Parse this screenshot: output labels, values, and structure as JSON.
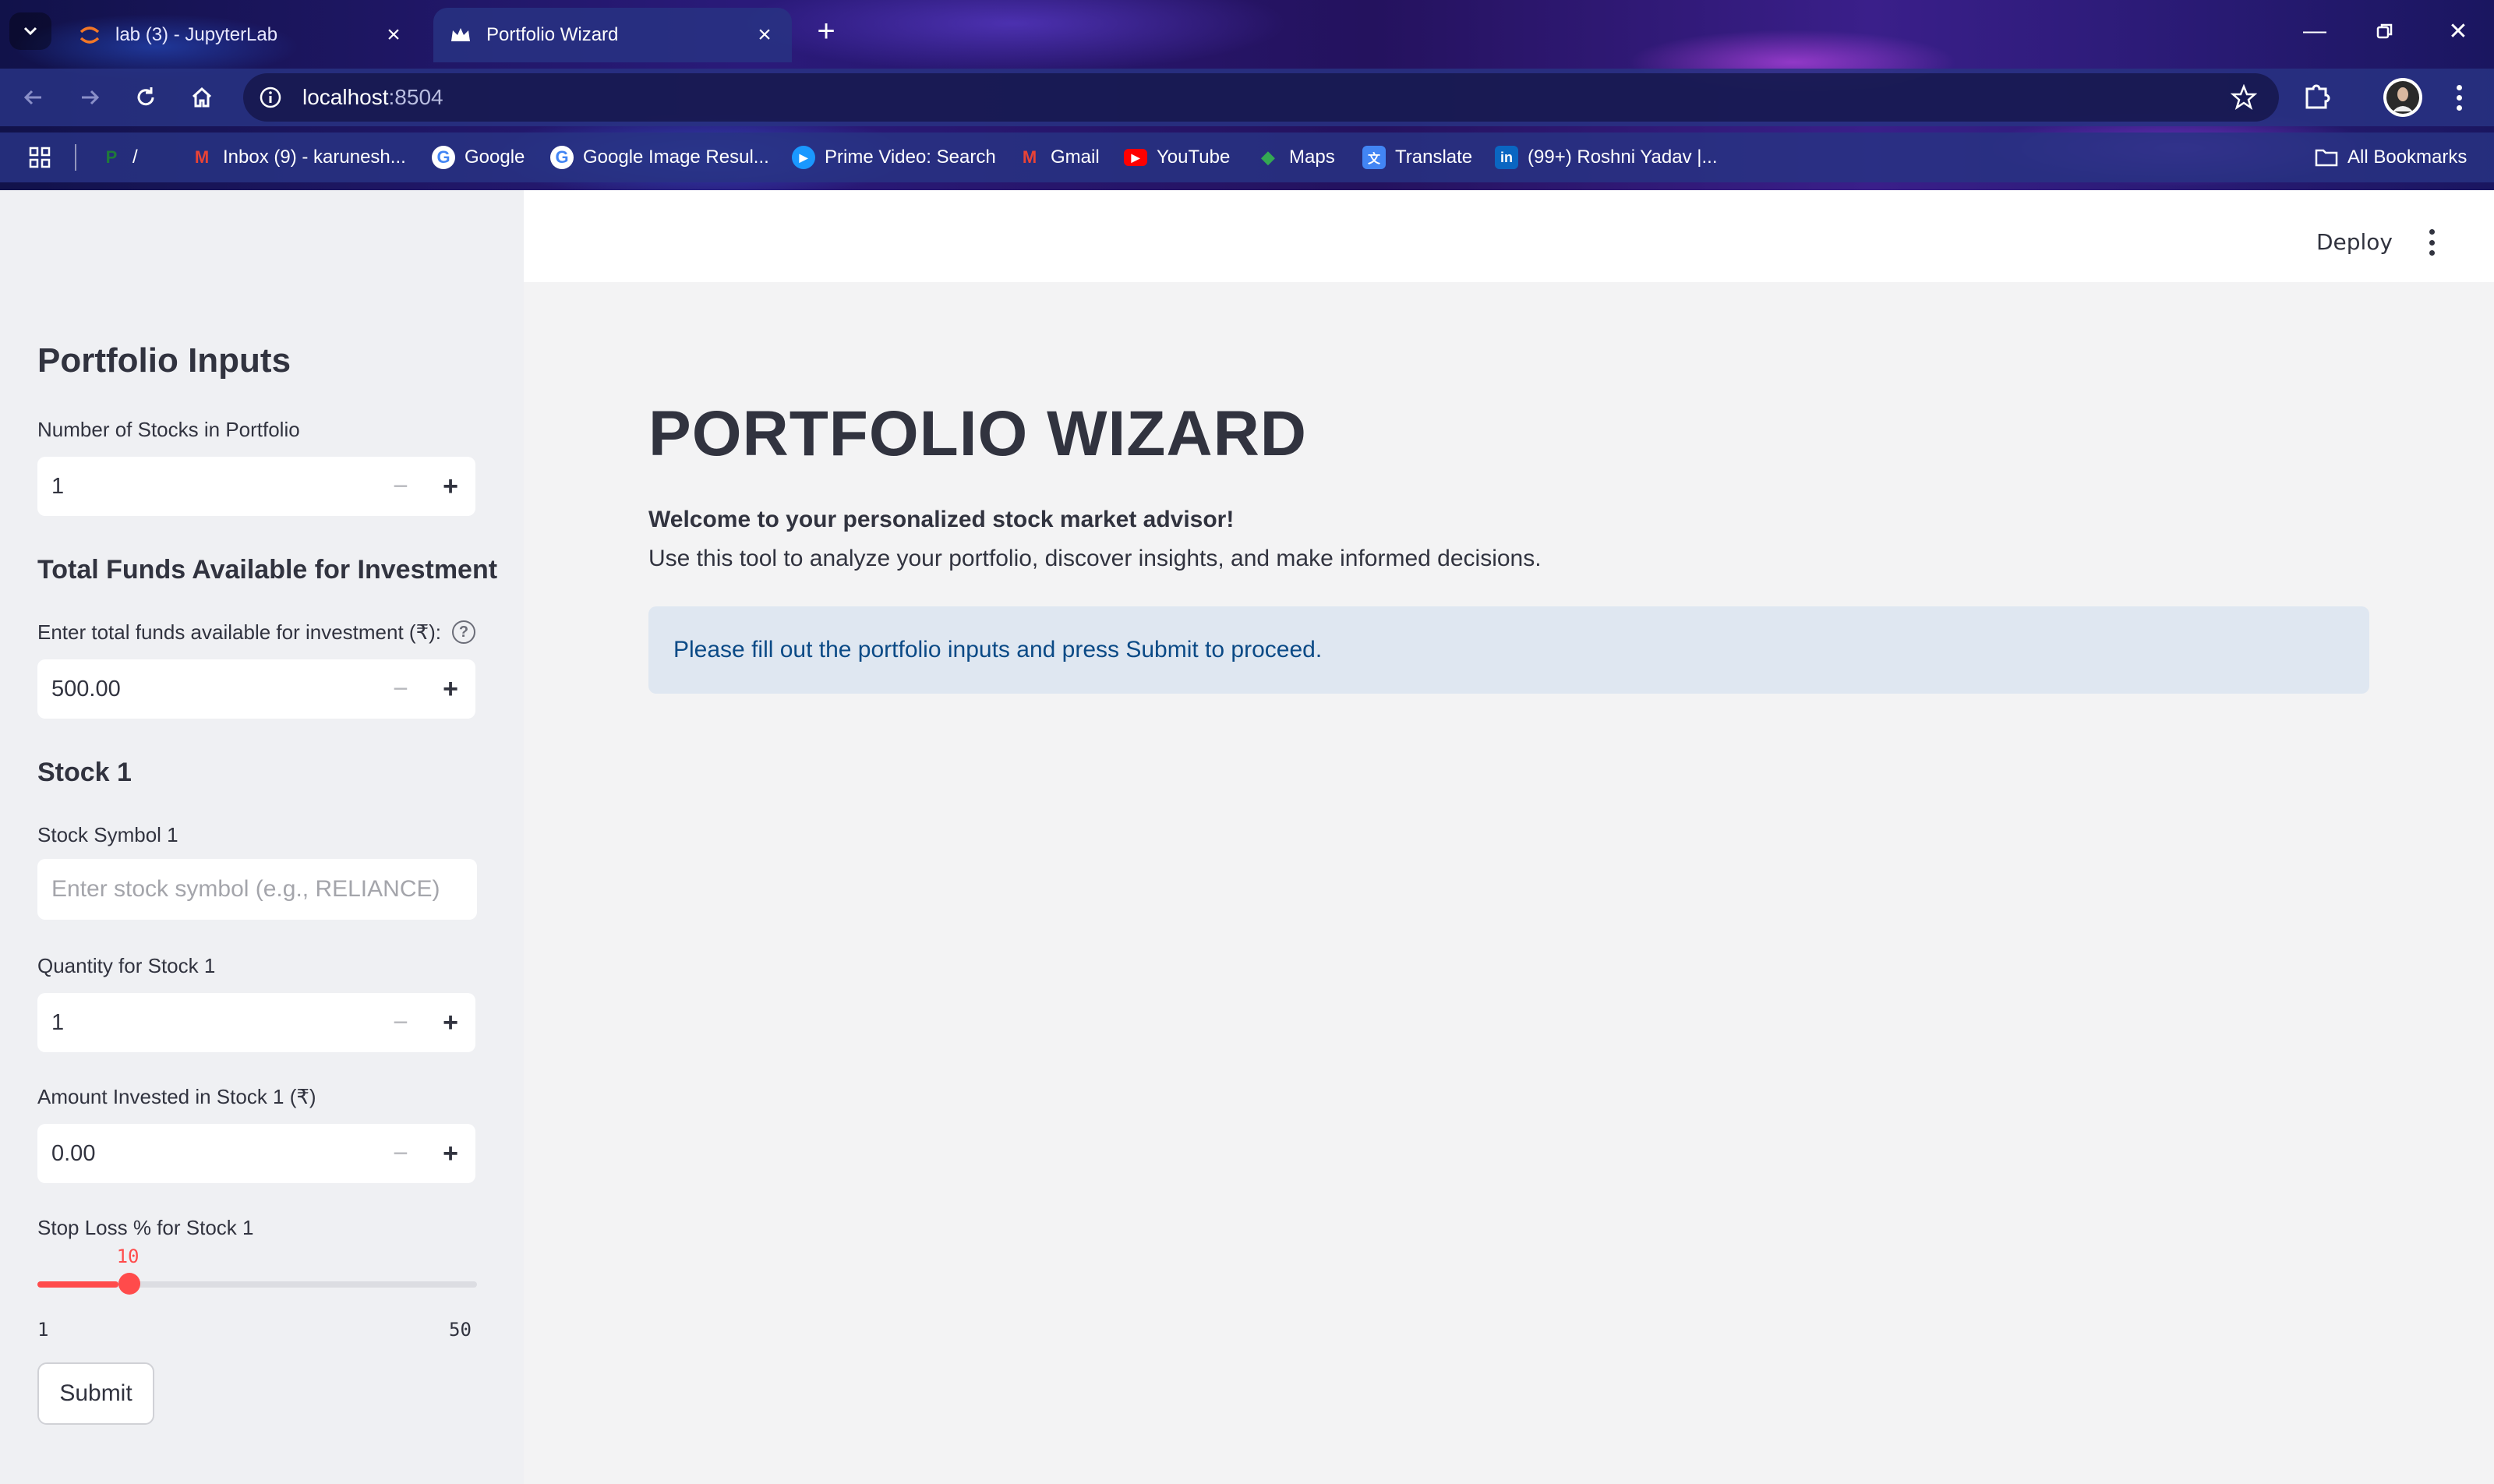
{
  "browser": {
    "tabs": [
      {
        "title": "lab (3) - JupyterLab",
        "active": false
      },
      {
        "title": "Portfolio Wizard",
        "active": true
      }
    ],
    "url_host": "localhost",
    "url_port": ":8504",
    "bookmarks": [
      {
        "label": "/",
        "icon": "pinterest-icon",
        "color": "#1f7a3a"
      },
      {
        "label": "Inbox (9) - karunesh...",
        "icon": "gmail-icon",
        "color": "#ea4335"
      },
      {
        "label": "Google",
        "icon": "google-icon",
        "color": "#4285f4"
      },
      {
        "label": "Google Image Resul...",
        "icon": "google-icon",
        "color": "#4285f4"
      },
      {
        "label": "Prime Video: Search",
        "icon": "prime-video-icon",
        "color": "#1a98ff"
      },
      {
        "label": "Gmail",
        "icon": "gmail-icon",
        "color": "#ea4335"
      },
      {
        "label": "YouTube",
        "icon": "youtube-icon",
        "color": "#ff0000"
      },
      {
        "label": "Maps",
        "icon": "maps-icon",
        "color": "#34a853"
      },
      {
        "label": "Translate",
        "icon": "translate-icon",
        "color": "#4285f4"
      },
      {
        "label": "(99+) Roshni Yadav |...",
        "icon": "linkedin-icon",
        "color": "#0a66c2"
      }
    ],
    "all_bookmarks": "All Bookmarks"
  },
  "header": {
    "deploy_label": "Deploy"
  },
  "sidebar": {
    "title": "Portfolio Inputs",
    "num_stocks_label": "Number of Stocks in Portfolio",
    "num_stocks_value": "1",
    "funds_heading": "Total Funds Available for Investment",
    "funds_label": "Enter total funds available for investment (₹):",
    "funds_value": "500.00",
    "stock_heading": "Stock 1",
    "symbol_label": "Stock Symbol 1",
    "symbol_placeholder": "Enter stock symbol (e.g., RELIANCE)",
    "quantity_label": "Quantity for Stock 1",
    "quantity_value": "1",
    "amount_label": "Amount Invested in Stock 1 (₹)",
    "amount_value": "0.00",
    "stoploss_label": "Stop Loss % for Stock 1",
    "stoploss_value": 10,
    "stoploss_min": 1,
    "stoploss_max": 50,
    "submit_label": "Submit"
  },
  "main": {
    "title": "PORTFOLIO WIZARD",
    "welcome": "Welcome to your personalized stock market advisor!",
    "description": "Use this tool to analyze your portfolio, discover insights, and make informed decisions.",
    "info": "Please fill out the portfolio inputs and press Submit to proceed."
  },
  "colors": {
    "accent": "#ff4b4b",
    "info_bg": "#dfe7f1",
    "info_text": "#0b4a86",
    "text": "#31333f"
  }
}
